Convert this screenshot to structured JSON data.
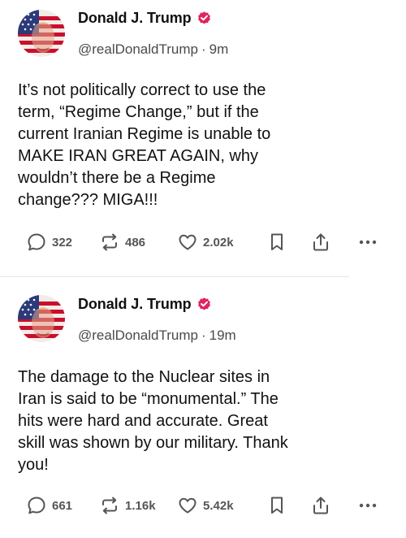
{
  "posts": [
    {
      "author": {
        "display_name": "Donald J. Trump",
        "handle": "@realDonaldTrump",
        "verified": true,
        "avatar_icon": "flag-portrait-avatar"
      },
      "separator": "·",
      "time": "9m",
      "text_lines": [
        "It’s not politically correct to use the",
        "term, “Regime Change,” but if the",
        "current Iranian Regime is unable to",
        "MAKE IRAN GREAT AGAIN, why",
        "wouldn’t there be a Regime",
        "change??? MIGA!!!"
      ],
      "stats": {
        "replies": "322",
        "reposts": "486",
        "likes": "2.02k"
      }
    },
    {
      "author": {
        "display_name": "Donald J. Trump",
        "handle": "@realDonaldTrump",
        "verified": true,
        "avatar_icon": "flag-portrait-avatar"
      },
      "separator": "·",
      "time": "19m",
      "text_lines": [
        "The damage to the Nuclear sites in",
        "Iran is said to be “monumental.” The",
        "hits were hard and accurate. Great",
        "skill was shown by our military. Thank",
        "you!"
      ],
      "stats": {
        "replies": "661",
        "reposts": "1.16k",
        "likes": "5.42k"
      }
    }
  ],
  "icons": {
    "reply": "comment-bubble-icon",
    "repost": "repost-arrows-icon",
    "like": "heart-icon",
    "bookmark": "bookmark-icon",
    "share": "share-upload-icon",
    "more": "more-dots-icon",
    "verified": "verified-badge-icon"
  },
  "colors": {
    "verified_badge": "#e0245e",
    "text": "#111111",
    "secondary_text": "#4a4a4a",
    "action_icon": "#555555"
  }
}
